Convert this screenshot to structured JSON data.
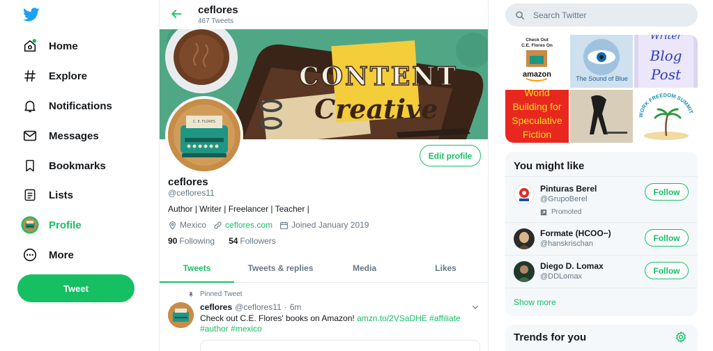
{
  "colors": {
    "accent": "#17bf63",
    "text": "#14171a",
    "muted": "#657786",
    "border": "#e6ecf0"
  },
  "sidebar": {
    "logo": "twitter-bird-icon",
    "items": [
      {
        "label": "Home",
        "icon": "home-icon",
        "notification_dot": true
      },
      {
        "label": "Explore",
        "icon": "hashtag-icon"
      },
      {
        "label": "Notifications",
        "icon": "bell-icon"
      },
      {
        "label": "Messages",
        "icon": "envelope-icon"
      },
      {
        "label": "Bookmarks",
        "icon": "bookmark-icon"
      },
      {
        "label": "Lists",
        "icon": "list-icon"
      },
      {
        "label": "Profile",
        "icon": "profile-avatar",
        "active": true
      },
      {
        "label": "More",
        "icon": "more-circle-icon"
      }
    ],
    "tweet_button": "Tweet"
  },
  "header": {
    "name": "ceflores",
    "tweet_count": "467 Tweets"
  },
  "banner": {
    "line1": "CONTENT",
    "line2": "Creative",
    "typewriter_label": "C. E. FLORES"
  },
  "profile": {
    "edit_button": "Edit profile",
    "name": "ceflores",
    "handle": "@ceflores11",
    "bio": "Author | Writer | Freelancer | Teacher |",
    "location": "Mexico",
    "website": "ceflores.com",
    "joined": "Joined January 2019",
    "following_count": "90",
    "following_label": "Following",
    "followers_count": "54",
    "followers_label": "Followers"
  },
  "tabs": [
    {
      "label": "Tweets",
      "active": true
    },
    {
      "label": "Tweets & replies"
    },
    {
      "label": "Media"
    },
    {
      "label": "Likes"
    }
  ],
  "pinned_tweet": {
    "pinned_label": "Pinned Tweet",
    "author": "ceflores",
    "handle": "@ceflores11",
    "separator": "·",
    "time": "6m",
    "text": "Check out C.E. Flores' books on Amazon!",
    "link": "amzn.to/2VSaDHE",
    "hashtags": [
      "#affiliate",
      "#author",
      "#mexico"
    ]
  },
  "search": {
    "placeholder": "Search Twitter"
  },
  "media_tiles": {
    "t1_line1": "Check Out",
    "t1_line2": "C.E. Flores On",
    "t1_logo": "amazon",
    "t2_caption": "The Sound of Blue",
    "t3_line1": "Writer",
    "t3_line2": "Blog",
    "t3_line3": "Post",
    "t4_text": "World Building for Speculative Fiction",
    "t6_text": "WORK FREEDOM SUMMIT"
  },
  "you_might_like": {
    "title": "You might like",
    "suggestions": [
      {
        "name": "Pinturas Berel",
        "handle": "@GrupoBerel",
        "promoted": "Promoted",
        "button": "Follow"
      },
      {
        "name": "Formate (HCOO−)",
        "handle": "@hanskrischan",
        "button": "Follow"
      },
      {
        "name": "Diego D. Lomax",
        "handle": "@DDLomax",
        "button": "Follow"
      }
    ],
    "show_more": "Show more"
  },
  "trends": {
    "title": "Trends for you"
  }
}
